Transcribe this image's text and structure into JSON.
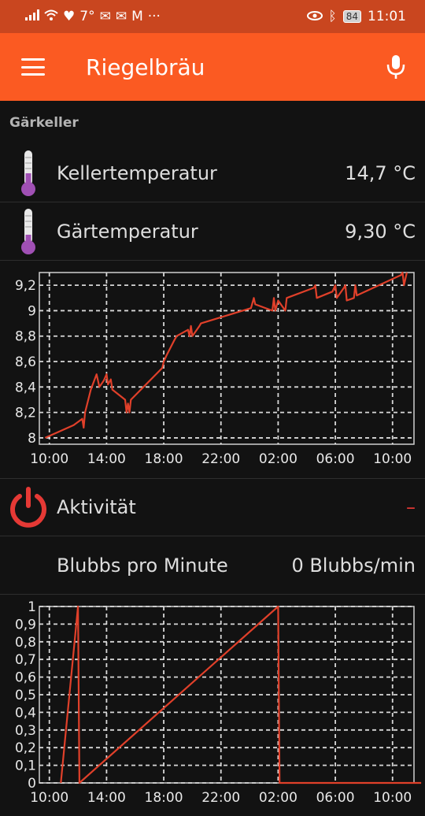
{
  "status_bar": {
    "temperature": "7°",
    "battery": "84",
    "time": "11:01"
  },
  "app_bar": {
    "title": "Riegelbräu"
  },
  "section": {
    "title": "Gärkeller"
  },
  "rows": [
    {
      "label": "Kellertemperatur",
      "value": "14,7 °C",
      "icon": "thermometer-icon"
    },
    {
      "label": "Gärtemperatur",
      "value": "9,30 °C",
      "icon": "thermometer-icon"
    },
    {
      "label": "Aktivität",
      "value": "–",
      "icon": "power-icon"
    },
    {
      "label": "Blubbs pro Minute",
      "value": "0 Blubbs/min",
      "icon": ""
    }
  ],
  "colors": {
    "accent": "#fb5a22",
    "statusbar": "#c9461f",
    "series": "#e0402a",
    "thermo_fill": "#a050b4",
    "power": "#e53935"
  },
  "chart_data": [
    {
      "type": "line",
      "title": "",
      "x_tick_labels": [
        "10:00",
        "14:00",
        "18:00",
        "22:00",
        "02:00",
        "06:00",
        "10:00"
      ],
      "y_tick_labels": [
        "8",
        "8,2",
        "8,4",
        "8,6",
        "8,8",
        "9",
        "9,2"
      ],
      "ylim": [
        7.95,
        9.3
      ],
      "xlim_hours": [
        9.3,
        11.4
      ],
      "grid": true,
      "series": [
        {
          "x_hours": [
            9.7,
            11.7,
            12.3,
            12.4,
            12.5,
            12.9,
            13.3,
            13.5,
            13.8,
            14.0,
            14.1,
            14.3,
            14.4,
            15.3,
            15.4,
            15.5,
            15.6,
            15.7,
            17.9,
            18.0,
            18.2,
            18.7,
            18.9,
            19.7,
            19.8,
            19.9,
            20.0,
            20.5,
            20.6,
            24.1,
            24.3,
            24.4,
            25.6,
            25.7,
            25.8,
            26.0,
            26.5,
            26.6,
            28.5,
            28.6,
            28.7,
            29.8,
            30.0,
            30.1,
            30.6,
            30.7,
            30.8,
            31.3,
            31.4,
            31.5,
            34.6,
            34.7,
            34.8,
            35.0
          ],
          "y": [
            8.0,
            8.1,
            8.15,
            8.08,
            8.2,
            8.38,
            8.5,
            8.4,
            8.45,
            8.5,
            8.42,
            8.46,
            8.38,
            8.3,
            8.2,
            8.27,
            8.2,
            8.3,
            8.55,
            8.6,
            8.65,
            8.76,
            8.8,
            8.85,
            8.8,
            8.88,
            8.8,
            8.88,
            8.9,
            9.02,
            9.1,
            9.05,
            9.0,
            9.1,
            9.0,
            9.08,
            9.0,
            9.1,
            9.18,
            9.2,
            9.1,
            9.15,
            9.2,
            9.1,
            9.18,
            9.2,
            9.08,
            9.1,
            9.2,
            9.12,
            9.28,
            9.3,
            9.2,
            9.3
          ],
          "note": "Gärtemperatur (°C)"
        }
      ]
    },
    {
      "type": "line",
      "x_tick_labels": [
        "10:00",
        "14:00",
        "18:00",
        "22:00",
        "02:00",
        "06:00",
        "10:00"
      ],
      "y_tick_labels": [
        "0",
        "0,1",
        "0,2",
        "0,3",
        "0,4",
        "0,5",
        "0,6",
        "0,7",
        "0,8",
        "0,9",
        "1"
      ],
      "ylim": [
        0,
        1
      ],
      "grid": true,
      "series": [
        {
          "x_hours": [
            10.8,
            12.0,
            12.1,
            26.0,
            26.1,
            36.0
          ],
          "y": [
            0.0,
            1.0,
            0.0,
            1.0,
            0.0,
            0.0
          ],
          "note": "Blubbs pro Minute"
        }
      ]
    }
  ]
}
